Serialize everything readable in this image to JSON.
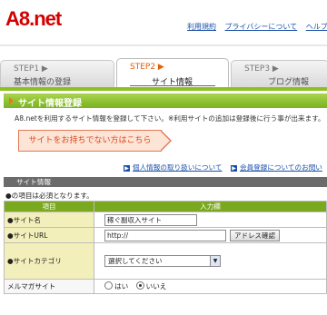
{
  "header": {
    "logo": "A8.net",
    "links": [
      "利用規約",
      "プライバシーについて",
      "ヘルプ"
    ]
  },
  "steps": [
    {
      "num": "STEP1 ▶",
      "title": "基本情報の登録"
    },
    {
      "num": "STEP2 ▶",
      "title": "サイト情報"
    },
    {
      "num": "STEP3 ▶",
      "title": "ブログ情報"
    }
  ],
  "section": {
    "title": "サイト情報登録",
    "intro": "A8.netを利用するサイト情報を登録して下さい。※利用サイトの追加は登録後に行う事が出来ます。",
    "nosite_button": "サイトをお持ちでない方はこちら",
    "link_privacy": "個人情報の取り扱いについて",
    "link_member": "会員登録についてのお問い"
  },
  "form": {
    "header": "サイト情報",
    "required_note": "●の項目は必須となります。",
    "col_item": "項目",
    "col_input": "入力欄",
    "rows": {
      "site_name": {
        "label": "●サイト名",
        "value": "稼ぐ副収入サイト"
      },
      "site_url": {
        "label": "●サイトURL",
        "value": "http://",
        "button": "アドレス確認"
      },
      "site_category": {
        "label": "●サイトカテゴリ",
        "value": "選択してください"
      },
      "mailmag": {
        "label": "メルマガサイト",
        "option_yes": "はい",
        "option_no": "いいえ",
        "selected": "いいえ"
      }
    }
  },
  "colors": {
    "accent_green": "#8cc11f",
    "logo_red": "#d40000",
    "step_orange": "#e0600a"
  }
}
